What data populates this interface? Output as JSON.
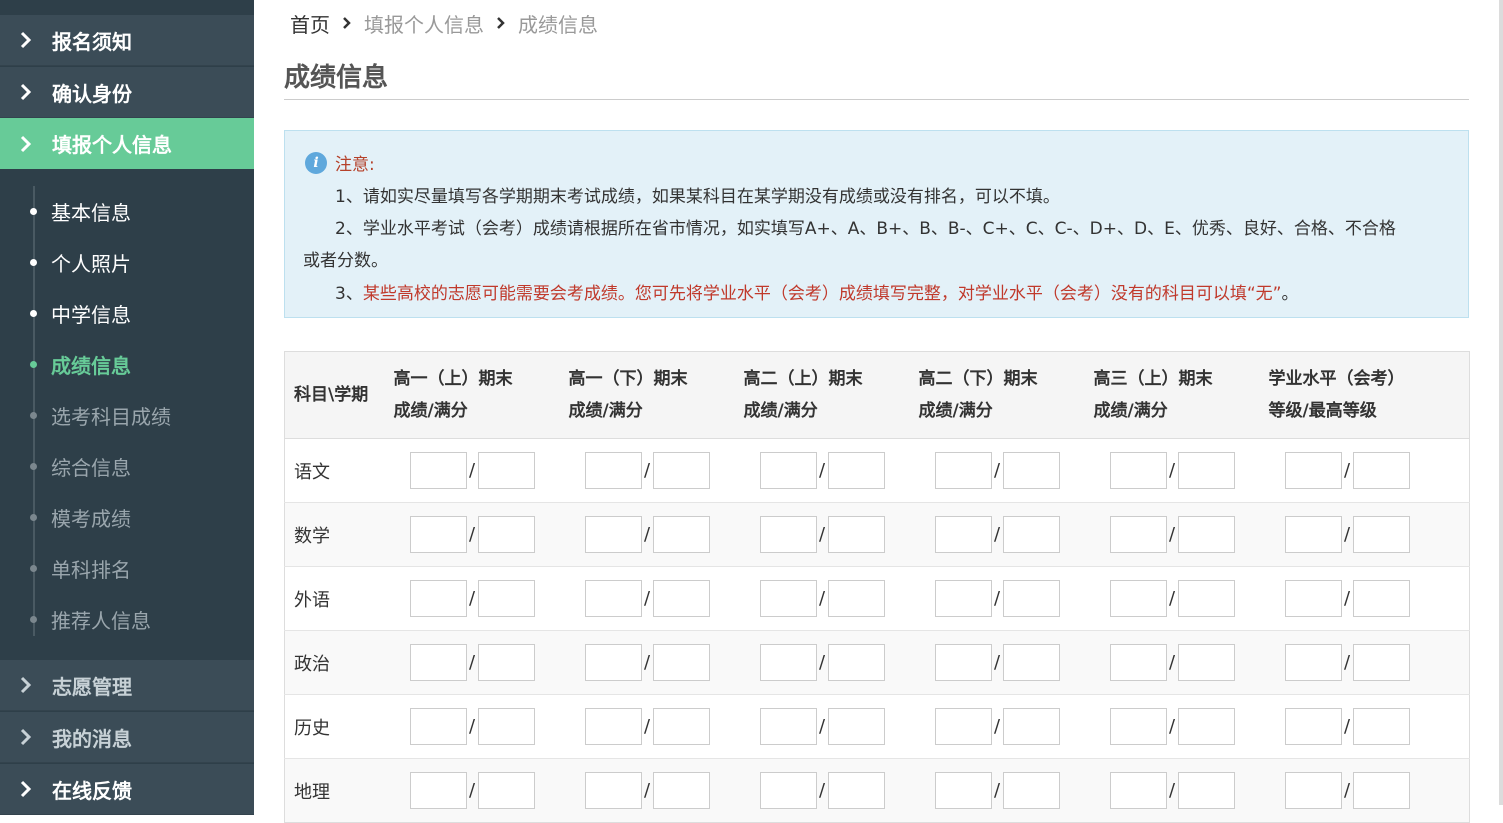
{
  "sidebar": {
    "top_items": [
      {
        "label": "报名须知",
        "icon": "chevron-right-icon"
      },
      {
        "label": "确认身份",
        "icon": "chevron-right-icon"
      },
      {
        "label": "填报个人信息",
        "icon": "chevron-right-icon",
        "active": true
      }
    ],
    "sub_items": [
      {
        "label": "基本信息"
      },
      {
        "label": "个人照片"
      },
      {
        "label": "中学信息"
      },
      {
        "label": "成绩信息",
        "current": true
      },
      {
        "label": "选考科目成绩"
      },
      {
        "label": "综合信息"
      },
      {
        "label": "模考成绩"
      },
      {
        "label": "单科排名"
      },
      {
        "label": "推荐人信息"
      }
    ],
    "bottom_items": [
      {
        "label": "志愿管理",
        "icon": "chevron-right-icon"
      },
      {
        "label": "我的消息",
        "icon": "chevron-right-icon"
      },
      {
        "label": "在线反馈",
        "icon": "chevron-right-icon"
      }
    ]
  },
  "breadcrumb": {
    "items": [
      "首页",
      "填报个人信息",
      "成绩信息"
    ],
    "separator_icon": "chevron-right-icon"
  },
  "page_title": "成绩信息",
  "notice": {
    "heading": "注意:",
    "line1": "1、请如实尽量填写各学期期末考试成绩，如果某科目在某学期没有成绩或没有排名，可以不填。",
    "line2a": "2、学业水平考试（会考）成绩请根据所在省市情况，如实填写A+、A、B+、B、B-、C+、C、C-、D+、D、E、优秀、良好、合格、不合格",
    "line2b": "或者分数。",
    "line3_prefix": "3、",
    "line3_red": "某些高校的志愿可能需要会考成绩。您可先将学业水平（会考）成绩填写完整，对学业水平（会考）没有的科目可以填“无”",
    "line3_suffix": "。"
  },
  "table": {
    "corner_header": "科目\\学期",
    "columns": [
      {
        "line1": "高一（上）期末",
        "line2": "成绩/满分"
      },
      {
        "line1": "高一（下）期末",
        "line2": "成绩/满分"
      },
      {
        "line1": "高二（上）期末",
        "line2": "成绩/满分"
      },
      {
        "line1": "高二（下）期末",
        "line2": "成绩/满分"
      },
      {
        "line1": "高三（上）期末",
        "line2": "成绩/满分"
      },
      {
        "line1": "学业水平（会考）",
        "line2": "等级/最高等级"
      }
    ],
    "rows": [
      "语文",
      "数学",
      "外语",
      "政治",
      "历史",
      "地理"
    ],
    "separator": "/"
  },
  "colors": {
    "sidebar_bg": "#2e3f49",
    "nav_item_bg": "#3b4c57",
    "accent_green": "#67cb98",
    "notice_bg": "#e3f1f8",
    "notice_red": "#c0392b"
  }
}
